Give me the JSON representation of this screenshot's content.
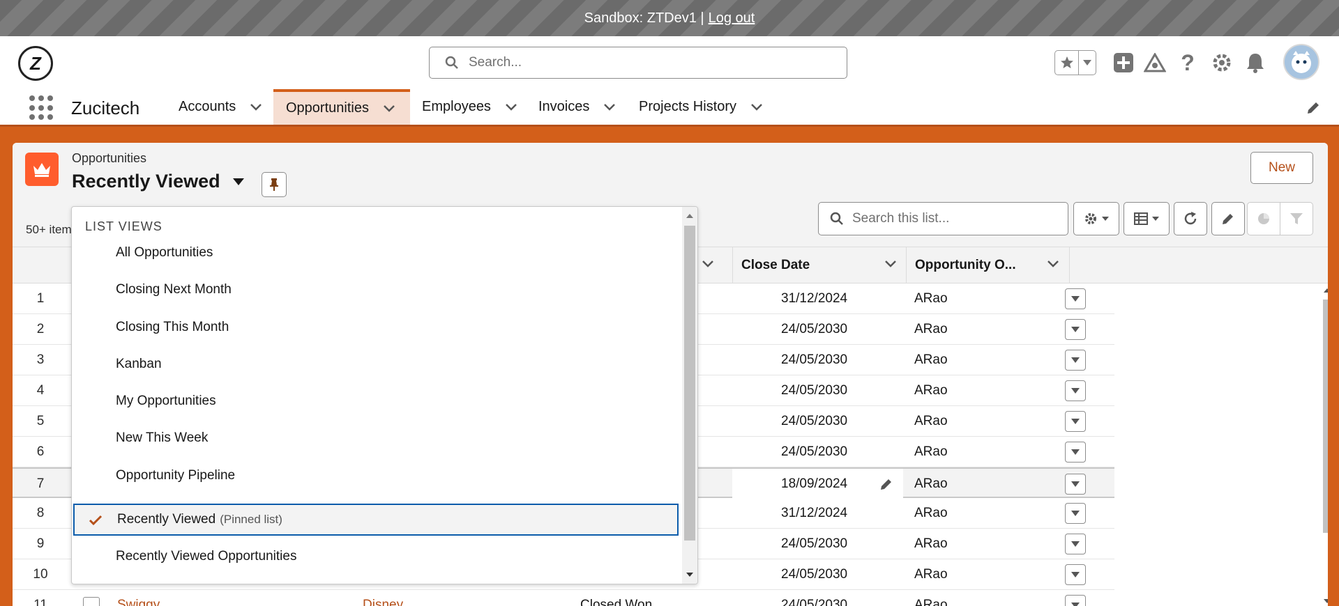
{
  "sandbox": {
    "text": "Sandbox: ZTDev1 |",
    "logout": "Log out"
  },
  "header": {
    "logo": "Z",
    "search_placeholder": "Search..."
  },
  "nav": {
    "app_name": "Zucitech",
    "items": [
      {
        "label": "Accounts"
      },
      {
        "label": "Opportunities",
        "active": true
      },
      {
        "label": "Employees"
      },
      {
        "label": "Invoices"
      },
      {
        "label": "Projects History"
      }
    ]
  },
  "list": {
    "object_label": "Opportunities",
    "view_title": "Recently Viewed",
    "new_label": "New",
    "item_count": "50+ item",
    "search_placeholder": "Search this list...",
    "columns": {
      "close_date": "Close Date",
      "owner": "Opportunity O..."
    },
    "rows": [
      {
        "num": "1",
        "date": "31/12/2024",
        "owner": "ARao"
      },
      {
        "num": "2",
        "date": "24/05/2030",
        "owner": "ARao"
      },
      {
        "num": "3",
        "date": "24/05/2030",
        "owner": "ARao"
      },
      {
        "num": "4",
        "date": "24/05/2030",
        "owner": "ARao"
      },
      {
        "num": "5",
        "date": "24/05/2030",
        "owner": "ARao"
      },
      {
        "num": "6",
        "date": "24/05/2030",
        "owner": "ARao"
      },
      {
        "num": "7",
        "date": "18/09/2024",
        "owner": "ARao"
      },
      {
        "num": "8",
        "date": "31/12/2024",
        "owner": "ARao"
      },
      {
        "num": "9",
        "date": "24/05/2030",
        "owner": "ARao"
      },
      {
        "num": "10",
        "date": "24/05/2030",
        "owner": "ARao"
      },
      {
        "num": "11",
        "name": "Swiggy",
        "account": "Disney",
        "stage": "Closed Won",
        "date": "24/05/2030",
        "owner": "ARao"
      }
    ]
  },
  "dropdown": {
    "heading": "LIST VIEWS",
    "items": [
      {
        "label": "All Opportunities"
      },
      {
        "label": "Closing Next Month"
      },
      {
        "label": "Closing This Month"
      },
      {
        "label": "Kanban"
      },
      {
        "label": "My Opportunities"
      },
      {
        "label": "New This Week"
      },
      {
        "label": "Opportunity Pipeline"
      },
      {
        "label": "Recently Viewed",
        "sub": "(Pinned list)",
        "selected": true
      },
      {
        "label": "Recently Viewed Opportunities"
      }
    ]
  },
  "colors": {
    "brand": "#d35f1a",
    "link": "#b5501a",
    "focus": "#0b5cab",
    "object_icon": "#ff5d2d"
  }
}
